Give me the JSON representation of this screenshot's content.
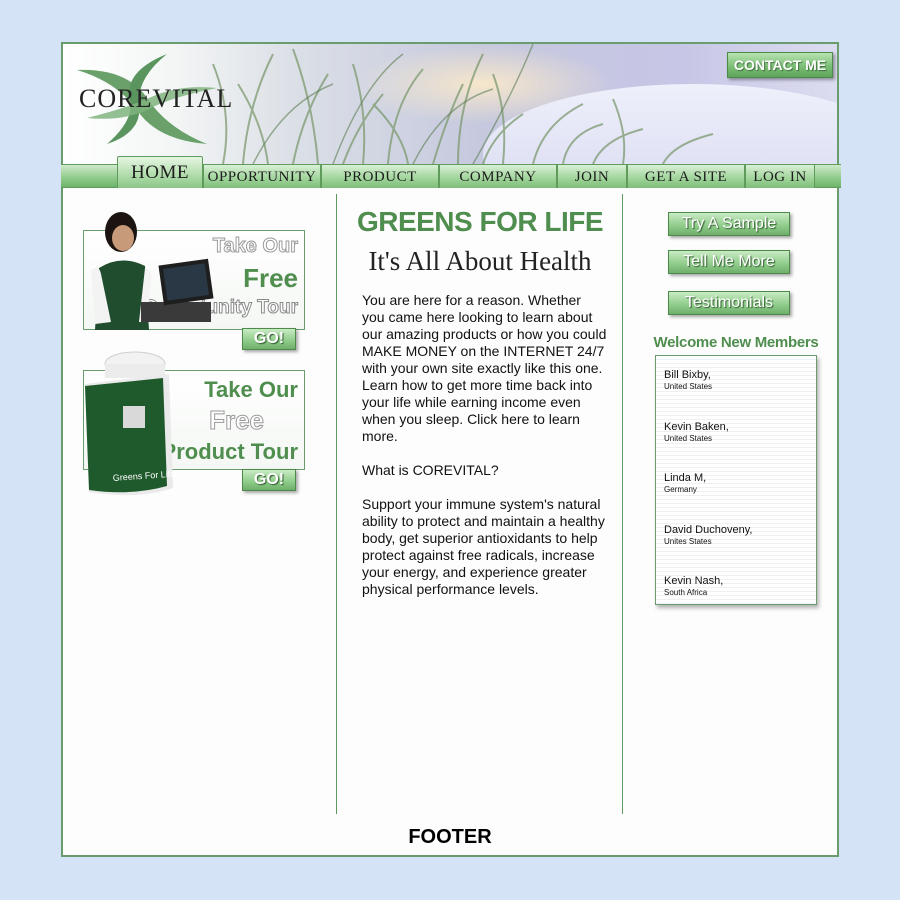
{
  "header": {
    "logo_text": "COREVITAL",
    "contact_button": "CONTACT ME"
  },
  "nav": {
    "tabs": [
      {
        "label": "HOME",
        "active": true
      },
      {
        "label": "OPPORTUNITY",
        "active": false
      },
      {
        "label": "PRODUCT",
        "active": false
      },
      {
        "label": "COMPANY",
        "active": false
      },
      {
        "label": "JOIN",
        "active": false
      },
      {
        "label": "GET A SITE",
        "active": false
      },
      {
        "label": "LOG IN",
        "active": false
      }
    ]
  },
  "left": {
    "opportunity_promo": {
      "line1": "Take Our",
      "line2": "Free",
      "line3": "Opportunity Tour",
      "button": "GO!"
    },
    "product_promo": {
      "line1": "Take Our",
      "line2": "Free",
      "line3": "Product Tour",
      "button": "GO!",
      "bottle_label": "Greens For Life"
    }
  },
  "center": {
    "headline": "GREENS FOR LIFE",
    "subheadline": "It's All About Health",
    "body": " You are here for a reason.  Whether you came here looking to learn about our amazing products or how you could MAKE MONEY on the INTERNET 24/7 with your own site exactly like this one. Learn how to get more time back into your life while earning income even when you sleep. Click here to learn more.\n\nWhat is COREVITAL?\n\nSupport your immune system's natural ability to protect and maintain a healthy body, get superior antioxidants to help protect against free radicals, increase your energy, and experience greater physical performance levels."
  },
  "right": {
    "buttons": [
      "Try A Sample",
      "Tell Me More",
      "Testimonials"
    ],
    "welcome_title": "Welcome New Members",
    "members": [
      {
        "name": "Bill Bixby,",
        "country": "United States"
      },
      {
        "name": "Kevin Baken,",
        "country": "United States"
      },
      {
        "name": "Linda M,",
        "country": "Germany"
      },
      {
        "name": "David Duchoveny,",
        "country": "Unites States"
      },
      {
        "name": "Kevin Nash,",
        "country": "South Africa"
      }
    ]
  },
  "footer": {
    "label": "FOOTER"
  },
  "colors": {
    "accent_green": "#4f8e4e",
    "page_background": "#d4e3f5",
    "border_green": "#6a9c6e"
  }
}
